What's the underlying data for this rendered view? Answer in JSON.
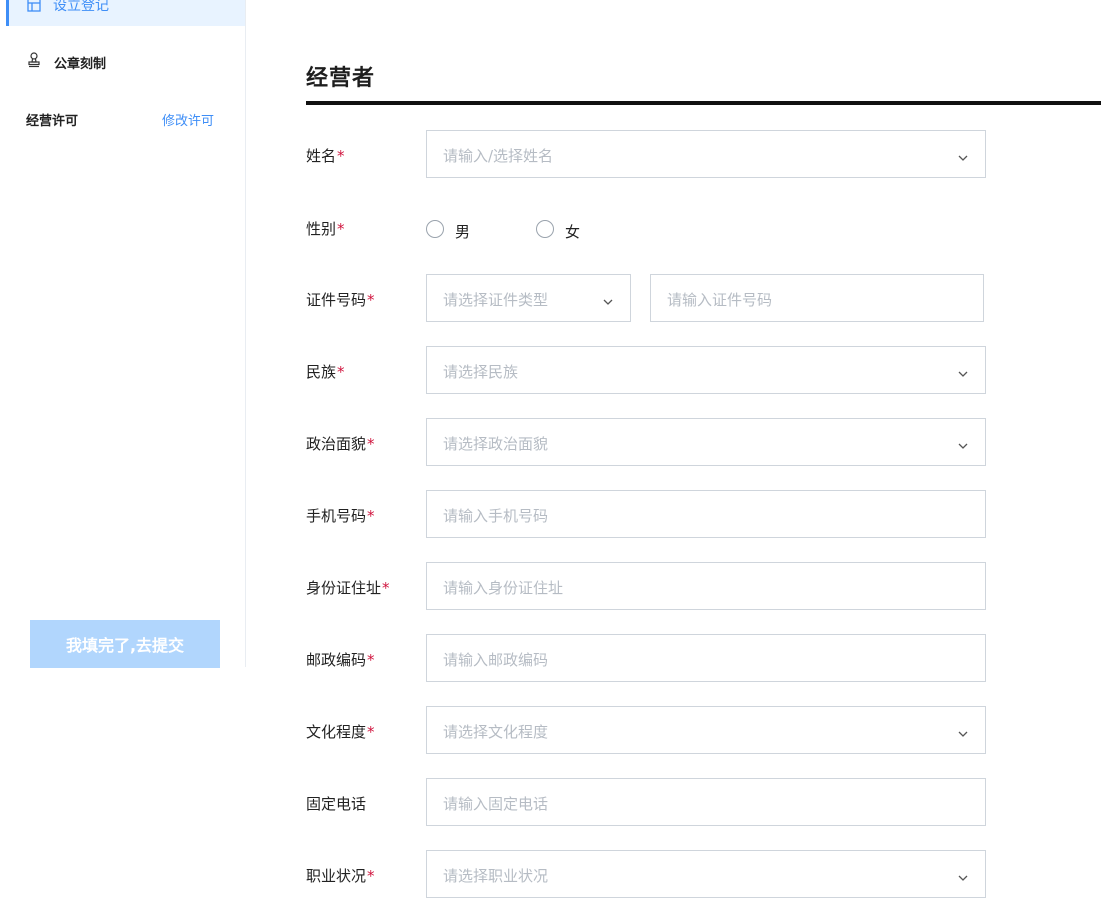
{
  "sidebar": {
    "active_item": "设立登记",
    "items": [
      {
        "label": "公章刻制",
        "icon": "stamp-icon"
      }
    ],
    "section_title": "经营许可",
    "section_link": "修改许可",
    "submit_label": "我填完了,去提交",
    "active_icon": "form-icon"
  },
  "main": {
    "title": "经营者",
    "required_mark": "*",
    "fields": {
      "name": {
        "label": "姓名",
        "placeholder": "请输入/选择姓名"
      },
      "gender": {
        "label": "性别",
        "options": [
          "男",
          "女"
        ]
      },
      "id_number": {
        "label": "证件号码",
        "type_placeholder": "请选择证件类型",
        "number_placeholder": "请输入证件号码"
      },
      "ethnicity": {
        "label": "民族",
        "placeholder": "请选择民族"
      },
      "political": {
        "label": "政治面貌",
        "placeholder": "请选择政治面貌"
      },
      "phone": {
        "label": "手机号码",
        "placeholder": "请输入手机号码"
      },
      "address": {
        "label": "身份证住址",
        "placeholder": "请输入身份证住址"
      },
      "postcode": {
        "label": "邮政编码",
        "placeholder": "请输入邮政编码"
      },
      "education": {
        "label": "文化程度",
        "placeholder": "请选择文化程度"
      },
      "landline": {
        "label": "固定电话",
        "placeholder": "请输入固定电话"
      },
      "occupation": {
        "label": "职业状况",
        "placeholder": "请选择职业状况"
      }
    }
  },
  "colors": {
    "accent": "#3e8ef7",
    "required": "#d0163f",
    "submit_bg": "#b1d6fd",
    "active_bg": "#e8f3ff"
  }
}
